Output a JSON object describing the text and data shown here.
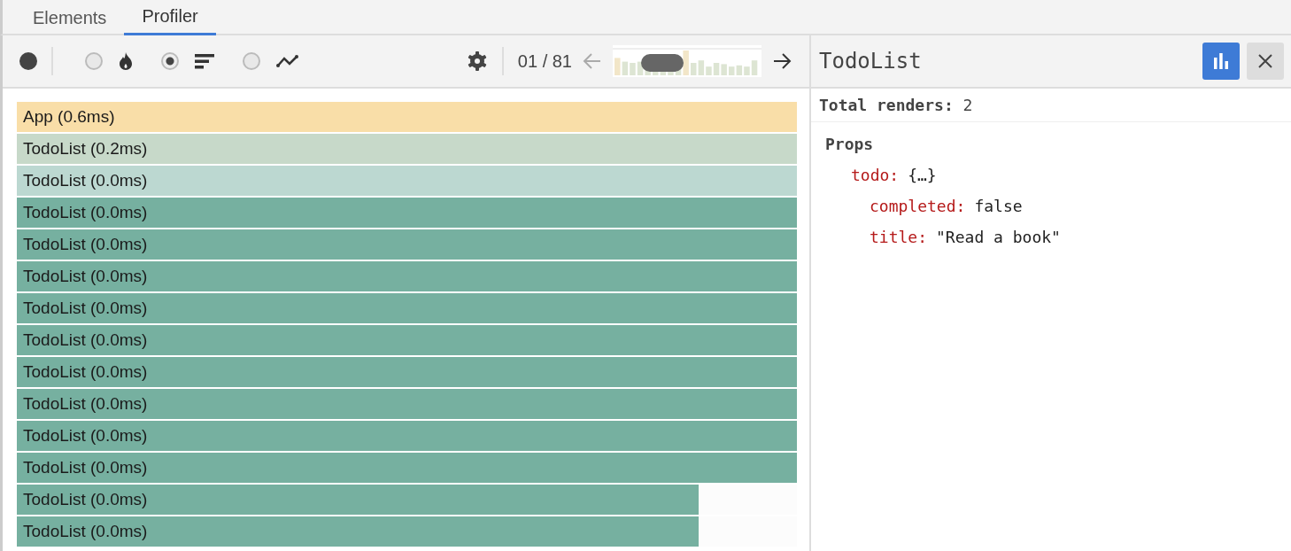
{
  "tabs": [
    {
      "label": "Elements",
      "selected": false
    },
    {
      "label": "Profiler",
      "selected": true
    }
  ],
  "toolbar": {
    "recording": false,
    "modes": [
      {
        "kind": "flame",
        "selected": false
      },
      {
        "kind": "ranked",
        "selected": true
      },
      {
        "kind": "interactions",
        "selected": false
      }
    ],
    "commit_counter": "01 / 81",
    "prev_disabled": true,
    "next_disabled": false
  },
  "bars": [
    {
      "label": "App (0.6ms)",
      "color": "#f9dea8",
      "level": 1
    },
    {
      "label": "TodoList (0.2ms)",
      "color": "#c7d9c9",
      "level": 1
    },
    {
      "label": "TodoList (0.0ms)",
      "color": "#bcd8d1",
      "level": 1
    },
    {
      "label": "TodoList (0.0ms)",
      "color": "#76b0a0",
      "level": 1
    },
    {
      "label": "TodoList (0.0ms)",
      "color": "#76b0a0",
      "level": 1
    },
    {
      "label": "TodoList (0.0ms)",
      "color": "#76b0a0",
      "level": 1
    },
    {
      "label": "TodoList (0.0ms)",
      "color": "#76b0a0",
      "level": 1
    },
    {
      "label": "TodoList (0.0ms)",
      "color": "#76b0a0",
      "level": 1
    },
    {
      "label": "TodoList (0.0ms)",
      "color": "#76b0a0",
      "level": 1
    },
    {
      "label": "TodoList (0.0ms)",
      "color": "#76b0a0",
      "level": 1
    },
    {
      "label": "TodoList (0.0ms)",
      "color": "#76b0a0",
      "level": 1
    },
    {
      "label": "TodoList (0.0ms)",
      "color": "#76b0a0",
      "level": 1
    },
    {
      "label": "TodoList (0.0ms)",
      "color": "#76b0a0",
      "level": 0.874
    },
    {
      "label": "TodoList (0.0ms)",
      "color": "#76b0a0",
      "level": 0.874
    }
  ],
  "detail": {
    "title": "TodoList",
    "chart_button_selected": true,
    "total_renders_label": "Total renders:",
    "total_renders": "2",
    "section_title": "Props",
    "props": [
      {
        "key": "todo:",
        "value": "{…}",
        "children": [
          {
            "key": "completed:",
            "value": "false"
          },
          {
            "key": "title:",
            "value": "\"Read a book\""
          }
        ]
      }
    ]
  }
}
